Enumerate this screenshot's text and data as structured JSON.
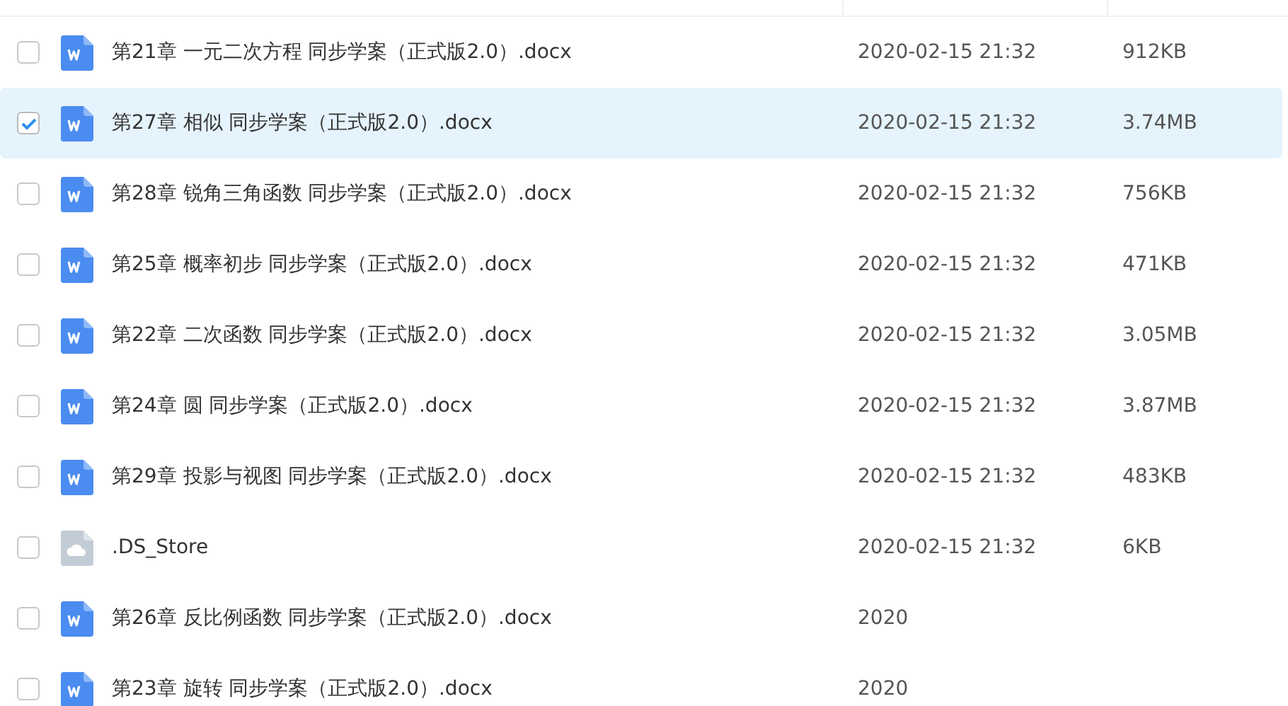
{
  "files": [
    {
      "kind": "word",
      "name": "第21章 一元二次方程 同步学案（正式版2.0）.docx",
      "modified": "2020-02-15 21:32",
      "size": "912KB",
      "selected": false
    },
    {
      "kind": "word",
      "name": "第27章 相似 同步学案（正式版2.0）.docx",
      "modified": "2020-02-15 21:32",
      "size": "3.74MB",
      "selected": true
    },
    {
      "kind": "word",
      "name": "第28章 锐角三角函数 同步学案（正式版2.0）.docx",
      "modified": "2020-02-15 21:32",
      "size": "756KB",
      "selected": false
    },
    {
      "kind": "word",
      "name": "第25章 概率初步 同步学案（正式版2.0）.docx",
      "modified": "2020-02-15 21:32",
      "size": "471KB",
      "selected": false
    },
    {
      "kind": "word",
      "name": "第22章 二次函数 同步学案（正式版2.0）.docx",
      "modified": "2020-02-15 21:32",
      "size": "3.05MB",
      "selected": false
    },
    {
      "kind": "word",
      "name": "第24章 圆 同步学案（正式版2.0）.docx",
      "modified": "2020-02-15 21:32",
      "size": "3.87MB",
      "selected": false
    },
    {
      "kind": "word",
      "name": "第29章 投影与视图 同步学案（正式版2.0）.docx",
      "modified": "2020-02-15 21:32",
      "size": "483KB",
      "selected": false
    },
    {
      "kind": "generic",
      "name": ".DS_Store",
      "modified": "2020-02-15 21:32",
      "size": "6KB",
      "selected": false
    },
    {
      "kind": "word",
      "name": "第26章 反比例函数 同步学案（正式版2.0）.docx",
      "modified": "2020",
      "selected": false
    },
    {
      "kind": "word",
      "name": "第23章 旋转 同步学案（正式版2.0）.docx",
      "modified": "2020",
      "selected": false
    }
  ]
}
